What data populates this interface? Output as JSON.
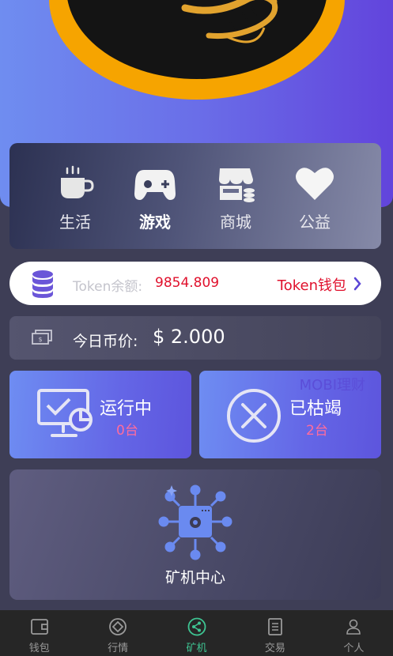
{
  "categories": [
    {
      "label": "生活",
      "icon": "coffee-cup-icon",
      "active": false
    },
    {
      "label": "游戏",
      "icon": "gamepad-icon",
      "active": true
    },
    {
      "label": "商城",
      "icon": "store-icon",
      "active": false
    },
    {
      "label": "公益",
      "icon": "heart-icon",
      "active": false
    }
  ],
  "token": {
    "label": "Token余额:",
    "value": "9854.809",
    "wallet_link": "Token钱包"
  },
  "price": {
    "label": "今日币价:",
    "value": "$ 2.000"
  },
  "running": {
    "title": "运行中",
    "count": "0台"
  },
  "depleted": {
    "title": "已枯竭",
    "count": "2台"
  },
  "watermark": "MOBI理财",
  "miner_center": {
    "label": "矿机中心"
  },
  "tabs": [
    {
      "label": "钱包",
      "icon": "wallet-icon",
      "active": false
    },
    {
      "label": "行情",
      "icon": "market-icon",
      "active": false
    },
    {
      "label": "矿机",
      "icon": "share-nodes-icon",
      "active": true
    },
    {
      "label": "交易",
      "icon": "document-icon",
      "active": false
    },
    {
      "label": "个人",
      "icon": "user-icon",
      "active": false
    }
  ],
  "colors": {
    "accent": "#6a6ee8",
    "token_value": "#e0102c",
    "count_pink": "#ff6c9c",
    "tab_active": "#3ec492",
    "logo_ring": "#f6a400"
  }
}
